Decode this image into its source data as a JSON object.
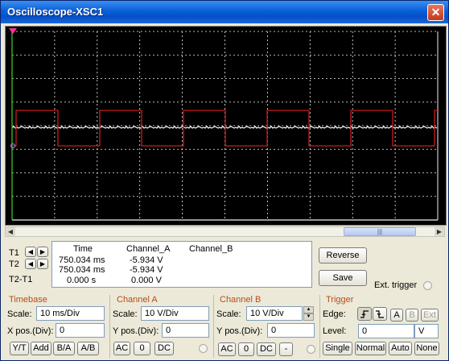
{
  "window": {
    "title": "Oscilloscope-XSC1",
    "close_label": "✕"
  },
  "scope": {
    "grid_color": "#f0f0f0",
    "channel_a_color": "#cc1b1b",
    "channel_b_color": "#ffffff",
    "cursor_t1_color": "#ff3399"
  },
  "readout": {
    "headers": {
      "time": "Time",
      "a": "Channel_A",
      "b": "Channel_B"
    },
    "rows": [
      {
        "label": "T1",
        "time": "750.034 ms",
        "a": "-5.934 V",
        "b": ""
      },
      {
        "label": "T2",
        "time": "750.034 ms",
        "a": "-5.934 V",
        "b": ""
      },
      {
        "label": "T2-T1",
        "time": "0.000 s",
        "a": "0.000 V",
        "b": ""
      }
    ],
    "arrow_left": "◀",
    "arrow_right": "▶"
  },
  "buttons": {
    "reverse": "Reverse",
    "save": "Save",
    "ext_trigger": "Ext. trigger"
  },
  "timebase": {
    "title": "Timebase",
    "scale_label": "Scale:",
    "scale_value": "10 ms/Div",
    "xpos_label": "X pos.(Div):",
    "xpos_value": "0",
    "modes": [
      "Y/T",
      "Add",
      "B/A",
      "A/B"
    ]
  },
  "channel_a": {
    "title": "Channel A",
    "scale_label": "Scale:",
    "scale_value": "10  V/Div",
    "ypos_label": "Y pos.(Div):",
    "ypos_value": "0",
    "coupling": [
      "AC",
      "0",
      "DC"
    ]
  },
  "channel_b": {
    "title": "Channel B",
    "scale_label": "Scale:",
    "scale_value": "10  V/Div",
    "ypos_label": "Y pos.(Div):",
    "ypos_value": "0",
    "coupling": [
      "AC",
      "0",
      "DC",
      "-"
    ]
  },
  "trigger": {
    "title": "Trigger",
    "edge_label": "Edge:",
    "edge_rise": "⨍",
    "edge_fall": "ꜱ",
    "sources": [
      "A",
      "B",
      "Ext"
    ],
    "level_label": "Level:",
    "level_value": "0",
    "level_unit": "V",
    "modes": [
      "Single",
      "Normal",
      "Auto",
      "None"
    ]
  }
}
